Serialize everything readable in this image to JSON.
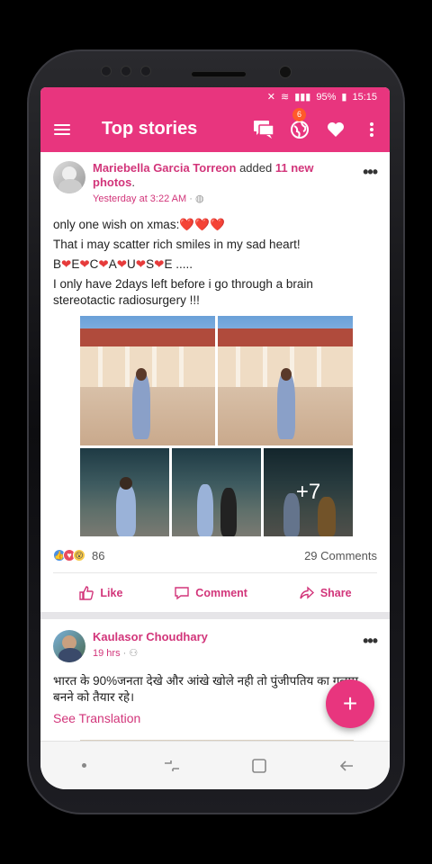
{
  "status_bar": {
    "battery_percent": "95%",
    "time": "15:15"
  },
  "app_bar": {
    "title": "Top stories",
    "notification_badge": "6",
    "icons": [
      "menu-icon",
      "messages-icon",
      "globe-notifications-icon",
      "heart-icon",
      "more-vert-icon"
    ]
  },
  "posts": [
    {
      "author": "Mariebella Garcia Torreon",
      "action_prefix": "added",
      "action_highlight": "11 new photos",
      "action_suffix": ".",
      "time": "Yesterday at 3:22 AM",
      "privacy_icon": "globe-icon",
      "text_lines": [
        "only one wish on xmas:",
        "That i may scatter rich smiles in my sad heart!",
        "B",
        "I only have 2days left before i go through a brain stereotactic radiosurgery !!!"
      ],
      "becauuse_letters": [
        "B",
        "E",
        "C",
        "A",
        "U",
        "S",
        "E",
        " ....."
      ],
      "more_photos_label": "+7",
      "reaction_count": "86",
      "comments_label": "29 Comments",
      "actions": [
        "Like",
        "Comment",
        "Share"
      ]
    },
    {
      "author": "Kaulasor Choudhary",
      "time": "19 hrs",
      "privacy_icon": "friends-icon",
      "text": "भारत के 90%जनता देखे और आंखे खोले नही तो पुंजीपतिय का गुलाम बनने को तैयार रहे।",
      "see_translation": "See Translation"
    }
  ],
  "fab": {
    "label": "+"
  },
  "colors": {
    "accent": "#e8357e",
    "link": "#d2357a"
  }
}
